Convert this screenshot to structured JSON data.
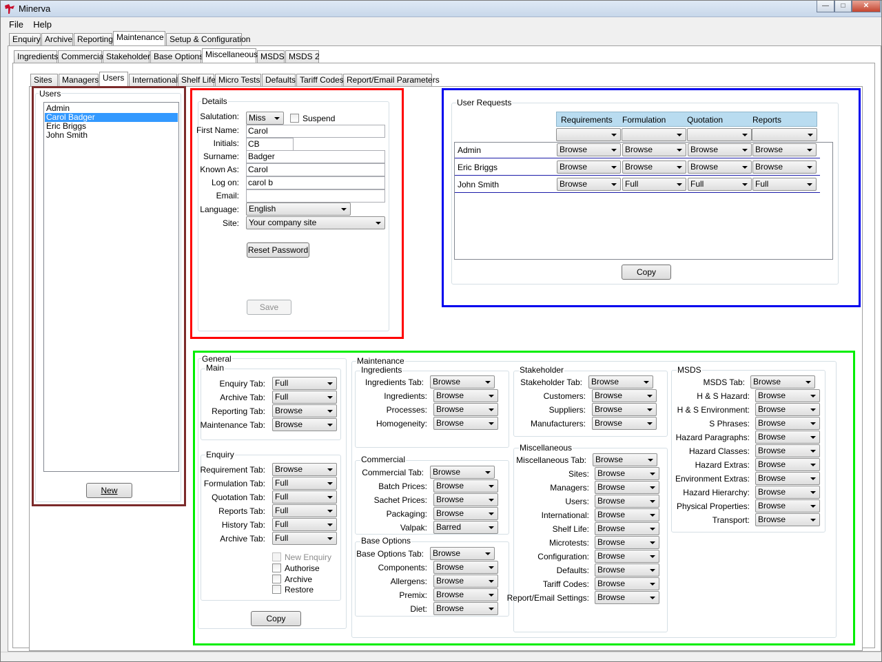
{
  "app": {
    "title": "Minerva"
  },
  "menu": [
    "File",
    "Help"
  ],
  "top_tabs": [
    "Enquiry",
    "Archive",
    "Reporting",
    "Maintenance",
    "Setup & Configuration"
  ],
  "maint_tabs": [
    "Ingredients",
    "Commercial",
    "Stakeholder",
    "Base Options",
    "Miscellaneous",
    "MSDS",
    "MSDS 2"
  ],
  "misc_tabs": [
    "Sites",
    "Managers",
    "Users",
    "International",
    "Shelf Life",
    "Micro Tests",
    "Defaults",
    "Tariff Codes",
    "Report/Email Parameters"
  ],
  "users": {
    "group_label": "Users",
    "list": [
      "Admin",
      "Carol Badger",
      "Eric Briggs",
      "John Smith"
    ],
    "selected": "Carol Badger",
    "new_button": "New"
  },
  "details": {
    "group_label": "Details",
    "salutation_label": "Salutation:",
    "salutation": "Miss",
    "suspend_label": "Suspend",
    "first_name_label": "First Name:",
    "first_name": "Carol",
    "initials_label": "Initials:",
    "initials": "CB",
    "surname_label": "Surname:",
    "surname": "Badger",
    "known_as_label": "Known As:",
    "known_as": "Carol",
    "logon_label": "Log on:",
    "logon": "carol b",
    "email_label": "Email:",
    "email": "",
    "language_label": "Language:",
    "language": "English",
    "site_label": "Site:",
    "site": "Your company site",
    "reset_password": "Reset Password",
    "save": "Save"
  },
  "user_requests": {
    "group_label": "User Requests",
    "columns": [
      "Requirements",
      "Formulation",
      "Quotation",
      "Reports"
    ],
    "rows": [
      {
        "name": "Admin",
        "values": [
          "Browse",
          "Browse",
          "Browse",
          "Browse"
        ]
      },
      {
        "name": "Eric Briggs",
        "values": [
          "Browse",
          "Browse",
          "Browse",
          "Browse"
        ]
      },
      {
        "name": "John Smith",
        "values": [
          "Browse",
          "Full",
          "Full",
          "Full"
        ]
      }
    ],
    "copy": "Copy"
  },
  "general": {
    "group_label": "General",
    "main_label": "Main",
    "main": [
      {
        "label": "Enquiry Tab:",
        "value": "Full"
      },
      {
        "label": "Archive Tab:",
        "value": "Full"
      },
      {
        "label": "Reporting Tab:",
        "value": "Browse"
      },
      {
        "label": "Maintenance Tab:",
        "value": "Browse"
      }
    ],
    "enquiry_label": "Enquiry",
    "enquiry": [
      {
        "label": "Requirement Tab:",
        "value": "Browse"
      },
      {
        "label": "Formulation Tab:",
        "value": "Full"
      },
      {
        "label": "Quotation Tab:",
        "value": "Full"
      },
      {
        "label": "Reports Tab:",
        "value": "Full"
      },
      {
        "label": "History Tab:",
        "value": "Full"
      },
      {
        "label": "Archive Tab:",
        "value": "Full"
      }
    ],
    "checks": [
      {
        "label": "New Enquiry",
        "disabled": true
      },
      {
        "label": "Authorise",
        "disabled": false
      },
      {
        "label": "Archive",
        "disabled": false
      },
      {
        "label": "Restore",
        "disabled": false
      }
    ],
    "copy": "Copy"
  },
  "maintenance": {
    "group_label": "Maintenance",
    "ingredients_label": "Ingredients",
    "ingredients": [
      {
        "label": "Ingredients Tab:",
        "value": "Browse"
      },
      {
        "label": "Ingredients:",
        "value": "Browse"
      },
      {
        "label": "Processes:",
        "value": "Browse"
      },
      {
        "label": "Homogeneity:",
        "value": "Browse"
      }
    ],
    "commercial_label": "Commercial",
    "commercial": [
      {
        "label": "Commercial Tab:",
        "value": "Browse"
      },
      {
        "label": "Batch Prices:",
        "value": "Browse"
      },
      {
        "label": "Sachet Prices:",
        "value": "Browse"
      },
      {
        "label": "Packaging:",
        "value": "Browse"
      },
      {
        "label": "Valpak:",
        "value": "Barred"
      }
    ],
    "base_options_label": "Base Options",
    "base_options": [
      {
        "label": "Base Options Tab:",
        "value": "Browse"
      },
      {
        "label": "Components:",
        "value": "Browse"
      },
      {
        "label": "Allergens:",
        "value": "Browse"
      },
      {
        "label": "Premix:",
        "value": "Browse"
      },
      {
        "label": "Diet:",
        "value": "Browse"
      }
    ],
    "stakeholder_label": "Stakeholder",
    "stakeholder": [
      {
        "label": "Stakeholder Tab:",
        "value": "Browse"
      },
      {
        "label": "Customers:",
        "value": "Browse"
      },
      {
        "label": "Suppliers:",
        "value": "Browse"
      },
      {
        "label": "Manufacturers:",
        "value": "Browse"
      }
    ],
    "misc_label": "Miscellaneous",
    "misc": [
      {
        "label": "Miscellaneous Tab:",
        "value": "Browse"
      },
      {
        "label": "Sites:",
        "value": "Browse"
      },
      {
        "label": "Managers:",
        "value": "Browse"
      },
      {
        "label": "Users:",
        "value": "Browse"
      },
      {
        "label": "International:",
        "value": "Browse"
      },
      {
        "label": "Shelf Life:",
        "value": "Browse"
      },
      {
        "label": "Microtests:",
        "value": "Browse"
      },
      {
        "label": "Configuration:",
        "value": "Browse"
      },
      {
        "label": "Defaults:",
        "value": "Browse"
      },
      {
        "label": "Tariff Codes:",
        "value": "Browse"
      },
      {
        "label": "Report/Email Settings:",
        "value": "Browse"
      }
    ],
    "msds_label": "MSDS",
    "msds": [
      {
        "label": "MSDS Tab:",
        "value": "Browse"
      },
      {
        "label": "H & S Hazard:",
        "value": "Browse"
      },
      {
        "label": "H & S Environment:",
        "value": "Browse"
      },
      {
        "label": "S Phrases:",
        "value": "Browse"
      },
      {
        "label": "Hazard Paragraphs:",
        "value": "Browse"
      },
      {
        "label": "Hazard Classes:",
        "value": "Browse"
      },
      {
        "label": "Hazard Extras:",
        "value": "Browse"
      },
      {
        "label": "Environment Extras:",
        "value": "Browse"
      },
      {
        "label": "Hazard Hierarchy:",
        "value": "Browse"
      },
      {
        "label": "Physical Properties:",
        "value": "Browse"
      },
      {
        "label": "Transport:",
        "value": "Browse"
      }
    ]
  },
  "highlight_colors": {
    "users": "#7b2a2a",
    "details": "#ff0000",
    "requests": "#0000ee",
    "permissions": "#00ee00"
  }
}
